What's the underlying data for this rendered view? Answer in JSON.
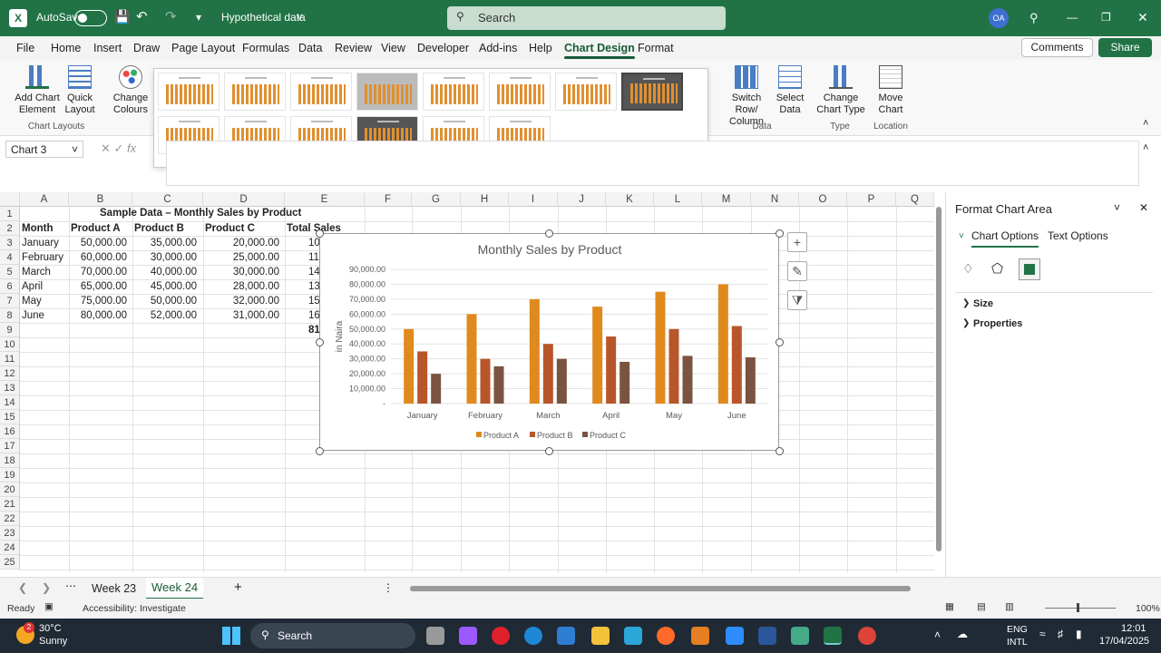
{
  "titlebar": {
    "autosave": "AutoSave",
    "filename": "Hypothetical data",
    "search": "Search",
    "avatar": "OA"
  },
  "menus": [
    "File",
    "Home",
    "Insert",
    "Draw",
    "Page Layout",
    "Formulas",
    "Data",
    "Review",
    "View",
    "Developer",
    "Add-ins",
    "Help",
    "Chart Design",
    "Format"
  ],
  "menu_active": "Chart Design",
  "buttons": {
    "comments": "Comments",
    "share": "Share"
  },
  "ribbon": {
    "add_chart_element": [
      "Add Chart",
      "Element"
    ],
    "quick_layout": [
      "Quick",
      "Layout"
    ],
    "change_colours": [
      "Change",
      "Colours"
    ],
    "group_chart_layouts": "Chart Layouts",
    "switch_row_col": [
      "Switch Row/",
      "Column"
    ],
    "select_data": [
      "Select",
      "Data"
    ],
    "group_data": "Data",
    "change_chart_type": [
      "Change",
      "Chart Type"
    ],
    "group_type": "Type",
    "move_chart": [
      "Move",
      "Chart"
    ],
    "group_location": "Location"
  },
  "namebox": "Chart 3",
  "fx": "fx",
  "columns": [
    "A",
    "B",
    "C",
    "D",
    "E",
    "F",
    "G",
    "H",
    "I",
    "J",
    "K",
    "L",
    "M",
    "N",
    "O",
    "P",
    "Q"
  ],
  "rows": [
    "1",
    "2",
    "3",
    "4",
    "5",
    "6",
    "7",
    "8",
    "9",
    "10",
    "11",
    "12",
    "13",
    "14",
    "15",
    "16",
    "17",
    "18",
    "19",
    "20",
    "21",
    "22",
    "23",
    "24",
    "25"
  ],
  "sheet": {
    "title": "Sample Data – Monthly Sales by Product",
    "headers": [
      "Month",
      "Product A",
      "Product B",
      "Product C",
      "Total Sales"
    ],
    "data": [
      [
        "January",
        "50,000.00",
        "35,000.00",
        "20,000.00",
        "10"
      ],
      [
        "February",
        "60,000.00",
        "30,000.00",
        "25,000.00",
        "11"
      ],
      [
        "March",
        "70,000.00",
        "40,000.00",
        "30,000.00",
        "14"
      ],
      [
        "April",
        "65,000.00",
        "45,000.00",
        "28,000.00",
        "13"
      ],
      [
        "May",
        "75,000.00",
        "50,000.00",
        "32,000.00",
        "15"
      ],
      [
        "June",
        "80,000.00",
        "52,000.00",
        "31,000.00",
        "16"
      ]
    ],
    "total_partial": "81"
  },
  "chart_data": {
    "type": "bar",
    "title": "Monthly Sales by Product",
    "ylabel": "in Naira",
    "xlabel": "",
    "categories": [
      "January",
      "February",
      "March",
      "April",
      "May",
      "June"
    ],
    "series": [
      {
        "name": "Product A",
        "values": [
          50000,
          60000,
          70000,
          65000,
          75000,
          80000
        ],
        "color": "#e08a1e"
      },
      {
        "name": "Product B",
        "values": [
          35000,
          30000,
          40000,
          45000,
          50000,
          52000
        ],
        "color": "#b8562b"
      },
      {
        "name": "Product C",
        "values": [
          20000,
          25000,
          30000,
          28000,
          32000,
          31000
        ],
        "color": "#7a5440"
      }
    ],
    "ylim": [
      0,
      90000
    ],
    "yticks": [
      "-",
      "10,000.00",
      "20,000.00",
      "30,000.00",
      "40,000.00",
      "50,000.00",
      "60,000.00",
      "70,000.00",
      "80,000.00",
      "90,000.00"
    ],
    "grid": true,
    "legend": "bottom"
  },
  "pane": {
    "title": "Format Chart Area",
    "tab1": "Chart Options",
    "tab2": "Text Options",
    "size": "Size",
    "properties": "Properties"
  },
  "sheettabs": [
    "Week 23",
    "Week 24"
  ],
  "status": {
    "ready": "Ready",
    "accessibility": "Accessibility: Investigate",
    "zoom": "100%"
  },
  "taskbar": {
    "temp": "30°C",
    "weather": "Sunny",
    "search": "Search",
    "lang1": "ENG",
    "lang2": "INTL",
    "time": "12:01",
    "date": "17/04/2025",
    "badge": "2"
  }
}
